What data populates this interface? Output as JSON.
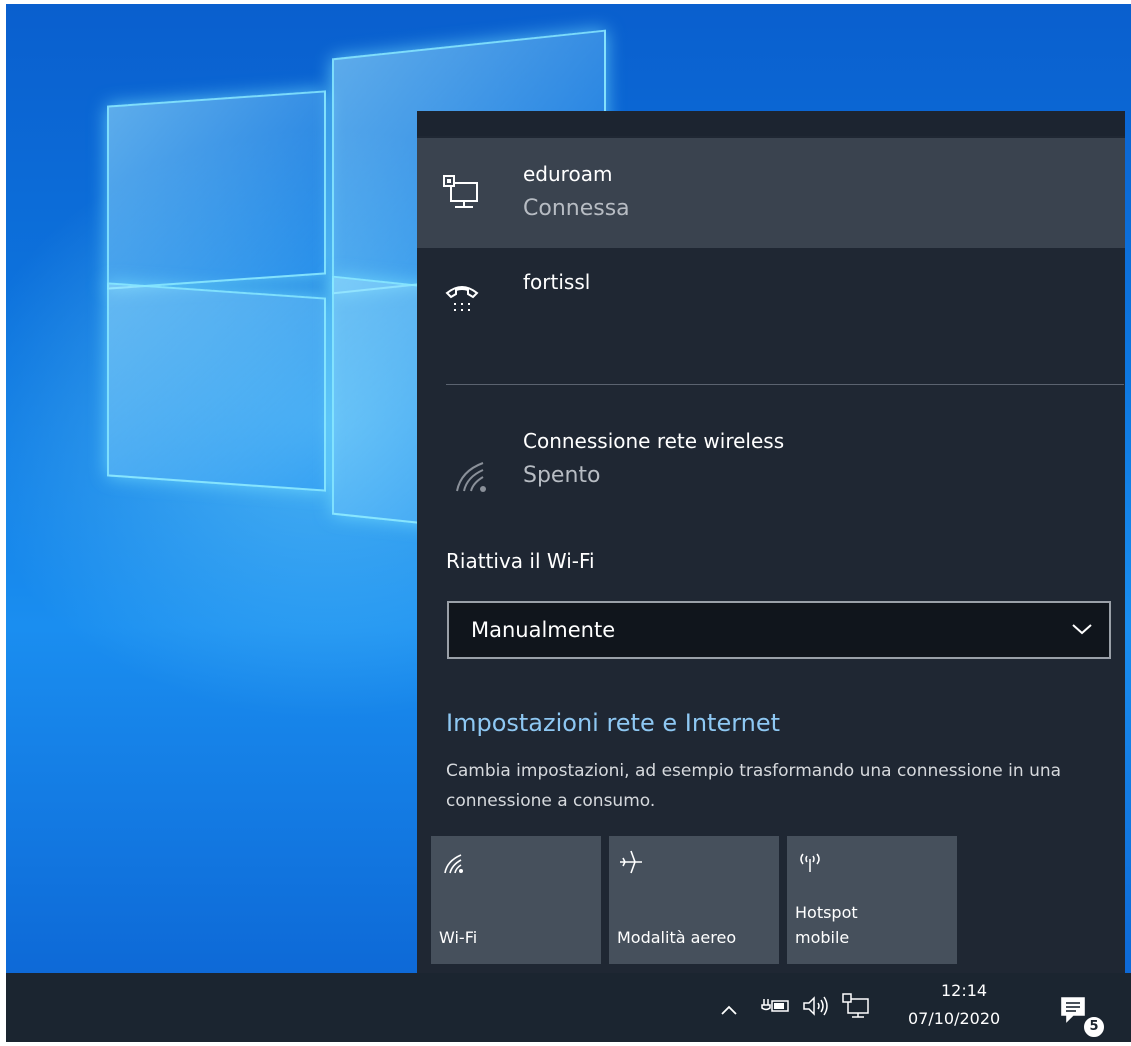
{
  "networks": [
    {
      "name": "eduroam",
      "status": "Connessa",
      "icon": "ethernet-icon",
      "selected": true
    },
    {
      "name": "fortissl",
      "status": "",
      "icon": "dialup-icon",
      "selected": false
    },
    {
      "name": "Connessione rete wireless",
      "status": "Spento",
      "icon": "wifi-off-icon",
      "selected": false
    }
  ],
  "wifi_reactivate": {
    "label": "Riattiva il Wi-Fi",
    "selected_value": "Manualmente"
  },
  "settings": {
    "link": "Impostazioni rete e Internet",
    "description": "Cambia impostazioni, ad esempio trasformando una connessione in una connessione a consumo."
  },
  "quick_actions": [
    {
      "label": "Wi-Fi",
      "icon": "wifi-icon"
    },
    {
      "label": "Modalità aereo",
      "icon": "airplane-icon"
    },
    {
      "label": "Hotspot mobile",
      "icon": "hotspot-icon"
    }
  ],
  "taskbar": {
    "time": "12:14",
    "date": "07/10/2020",
    "notification_count": "5",
    "tray_icons": [
      "chevron-up-icon",
      "power-icon",
      "volume-icon",
      "network-icon",
      "notification-icon"
    ]
  },
  "colors": {
    "flyout_bg": "#1f2733",
    "selected_row": "#3a434f",
    "link": "#8ec8f3",
    "tile_bg": "#46505c",
    "taskbar_bg": "#1b2530"
  }
}
